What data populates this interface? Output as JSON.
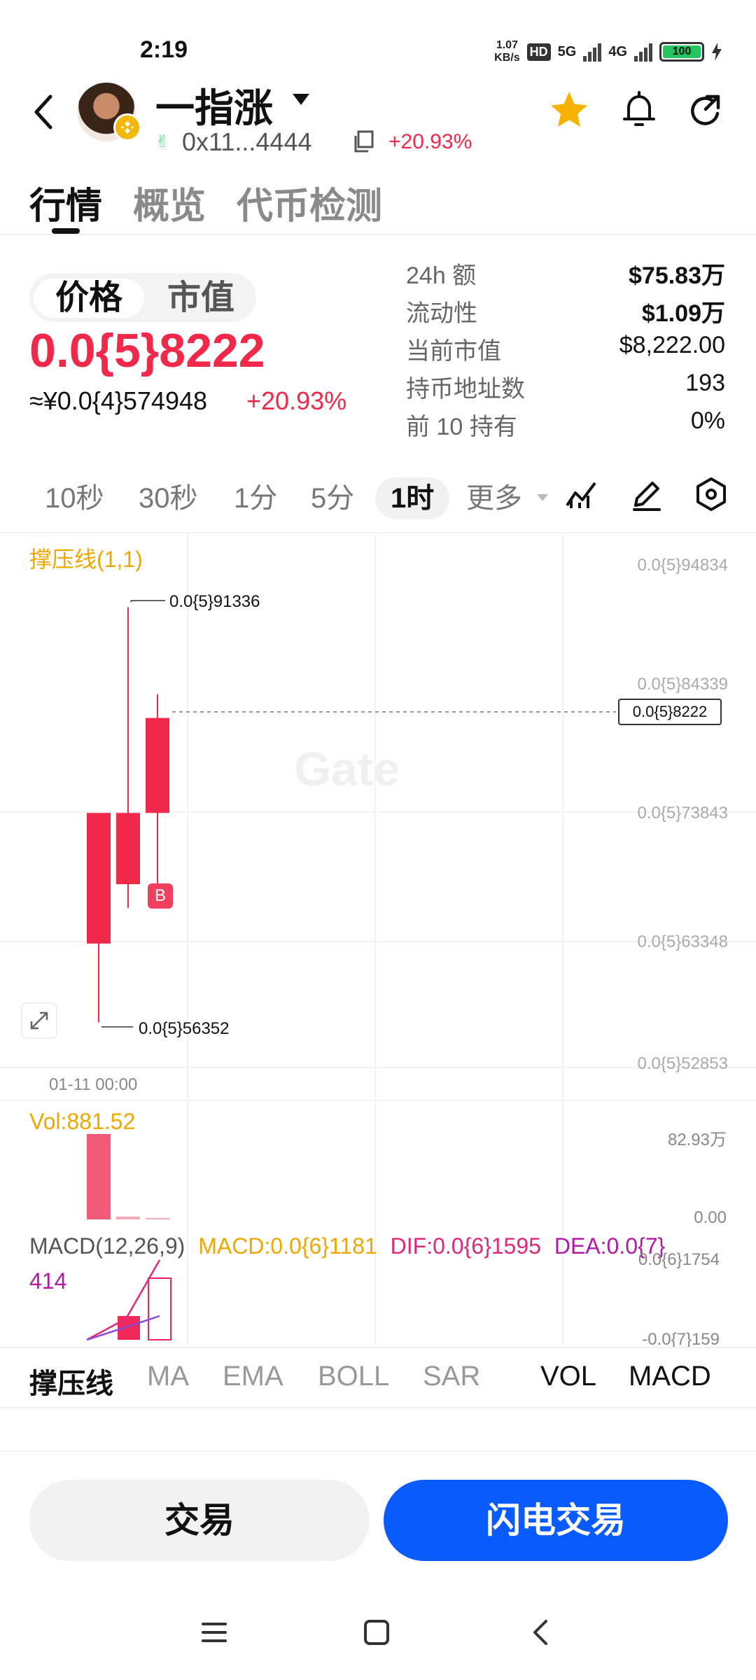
{
  "status_bar": {
    "time": "2:19",
    "net_speed_value": "1.07",
    "net_speed_unit": "KB/s",
    "hd": "HD",
    "sim1": "5G",
    "sim2": "4G",
    "battery": "100"
  },
  "header": {
    "token_name": "一指涨",
    "address": "0x11...4444",
    "change": "+20.93%",
    "icons": [
      "back-icon",
      "bnb-chain-icon",
      "dropdown-caret-icon",
      "copy-icon",
      "star-icon",
      "bell-icon",
      "share-icon"
    ]
  },
  "tabs": [
    "行情",
    "概览",
    "代币检测"
  ],
  "price_section": {
    "toggle": [
      "价格",
      "市值"
    ],
    "price": "0.0{5}8222",
    "cny_price": "≈¥0.0{4}574948",
    "cny_change": "+20.93%"
  },
  "stats": [
    {
      "label": "24h  额",
      "value": "$75.83万"
    },
    {
      "label": "流动性",
      "value": "$1.09万"
    },
    {
      "label": "当前市值",
      "value": "$8,222.00"
    },
    {
      "label": "持币地址数",
      "value": "193"
    },
    {
      "label": "前 10 持有",
      "value": "0%"
    }
  ],
  "timeframes": {
    "items": [
      "10秒",
      "30秒",
      "1分",
      "5分",
      "1时",
      "更多"
    ],
    "active": "1时"
  },
  "chart": {
    "indicator_title": "撑压线(1,1)",
    "price_axis": [
      "0.0{5}94834",
      "0.0{5}84339",
      "0.0{5}73843",
      "0.0{5}63348",
      "0.0{5}52853"
    ],
    "current_price": "0.0{5}8222",
    "high_label": "0.0{5}91336",
    "low_label": "0.0{5}56352",
    "buy_marker": "B",
    "watermark": "Gate",
    "x_axis_label": "01-11 00:00",
    "volume_label": "Vol:881.52",
    "volume_axis_top": "82.93万",
    "volume_axis_bottom": "0.00",
    "macd": {
      "name": "MACD(12,26,9)",
      "macd": "MACD:0.0{6}1181",
      "dif": "DIF:0.0{6}1595",
      "dea": "DEA:0.0{7}",
      "dea_cont": "414",
      "axis_top": "0.0{6}1754",
      "axis_bottom": "-0.0{7}159"
    }
  },
  "chart_data": {
    "type": "candlestick",
    "candles": [
      {
        "open": 6.3e-06,
        "high": 7.4e-06,
        "low": 5.6352e-06,
        "close": 7.4e-06
      },
      {
        "open": 6.8e-06,
        "high": 9.1336e-06,
        "low": 6.6e-06,
        "close": 7.4e-06
      },
      {
        "open": 7.4e-06,
        "high": 8.4e-06,
        "low": 6.7e-06,
        "close": 8.2e-06
      }
    ],
    "volume": [
      881.52,
      10,
      2
    ],
    "ylim": [
      5.2853e-06,
      9.4834e-06
    ]
  },
  "indicator_tabs": [
    "撑压线",
    "MA",
    "EMA",
    "BOLL",
    "SAR",
    "VOL",
    "MACD"
  ],
  "buttons": {
    "trade": "交易",
    "flash_trade": "闪电交易"
  },
  "colors": {
    "up": "#f0284a",
    "accent": "#0a5bfe",
    "indicator": "#f0a800"
  }
}
